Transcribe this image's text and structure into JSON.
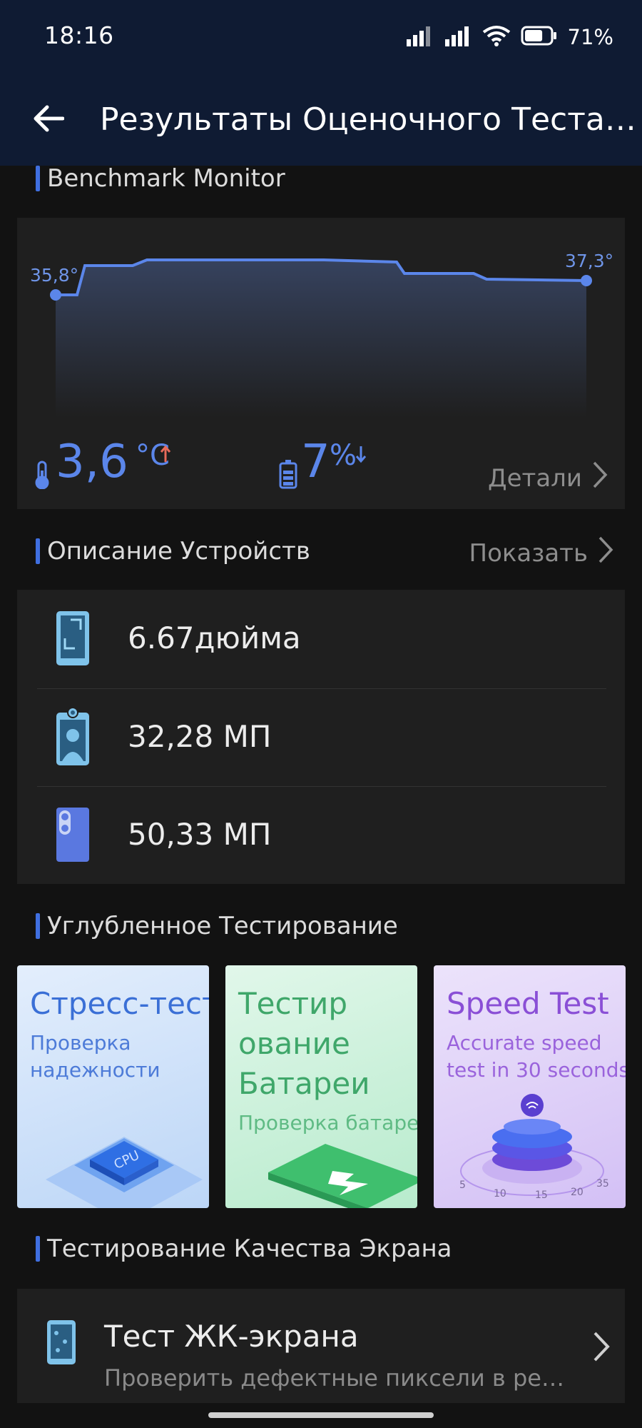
{
  "status_bar": {
    "time": "18:16",
    "battery_percent": "71%",
    "battery_level": 0.71
  },
  "app_bar": {
    "title": "Результаты Оценочного Теста…",
    "back_icon": "arrow-left-icon"
  },
  "benchmark_monitor": {
    "heading": "Benchmark Monitor",
    "start_temp_label": "35,8°",
    "end_temp_label": "37,3°",
    "temp_delta_value": "3,6",
    "temp_delta_unit": "°C",
    "battery_delta_value": "7",
    "battery_delta_unit": "%",
    "details_label": "Детали",
    "line_color": "#5b86ea",
    "up_arrow_color": "#e86a5a"
  },
  "device_description": {
    "heading": "Описание Устройств",
    "show_label": "Показать",
    "items": [
      {
        "icon": "screen-size-icon",
        "value": "6.67дюйма"
      },
      {
        "icon": "front-camera-icon",
        "value": "32,28 МП"
      },
      {
        "icon": "rear-camera-icon",
        "value": "50,33 МП"
      }
    ]
  },
  "deep_testing": {
    "heading": "Углубленное Тестирование",
    "tiles": [
      {
        "title": "Стресс-тест",
        "subtitle_1": "Проверка",
        "subtitle_2": "надежности",
        "art": "cpu-chip-icon"
      },
      {
        "title_1": "Тестир",
        "title_2": "ование",
        "title_3": "Батареи",
        "subtitle_1": "Проверка батареи",
        "art": "battery-charge-icon"
      },
      {
        "title": "Speed Test",
        "subtitle_1": "Accurate speed",
        "subtitle_2": "test in 30 seconds",
        "art": "speedometer-icon",
        "dial_ticks": [
          "5",
          "10",
          "15",
          "20",
          "35"
        ]
      }
    ]
  },
  "screen_quality": {
    "heading": "Тестирование Качества Экрана",
    "item_title": "Тест ЖК-экрана",
    "item_subtitle": "Проверить дефектные пиксели в ре…"
  }
}
